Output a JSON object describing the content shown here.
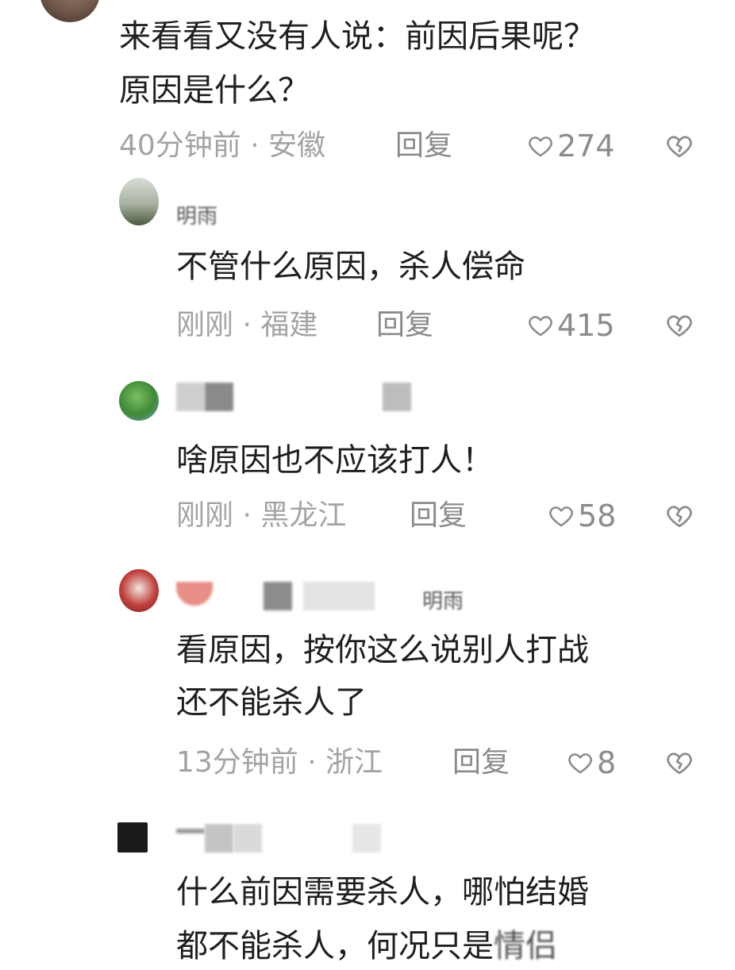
{
  "comments": [
    {
      "lines": [
        "来看看又没有人说：前因后果呢？",
        "原因是什么？"
      ],
      "time": "40分钟前",
      "location": "安徽",
      "reply": "回复",
      "likes": "274"
    },
    {
      "username_partial": "明雨",
      "lines": [
        "不管什么原因，杀人偿命"
      ],
      "time": "刚刚",
      "location": "福建",
      "reply": "回复",
      "likes": "415"
    },
    {
      "lines": [
        "啥原因也不应该打人！"
      ],
      "time": "刚刚",
      "location": "黑龙江",
      "reply": "回复",
      "likes": "58"
    },
    {
      "username_partial": "明雨",
      "lines": [
        "看原因，按你这么说别人打战",
        "还不能杀人了"
      ],
      "time": "13分钟前",
      "location": "浙江",
      "reply": "回复",
      "likes": "8"
    },
    {
      "lines": [
        "什么前因需要杀人，哪怕结婚",
        "都不能杀人，何况只是"
      ],
      "tail_partial": "情侣"
    }
  ],
  "separator": " · ",
  "icons": {
    "like": "heart-outline-icon",
    "dislike": "broken-heart-icon"
  },
  "colors": {
    "text": "#1f1f1f",
    "meta": "#a3a3a3",
    "icon": "#8b8b8b"
  }
}
